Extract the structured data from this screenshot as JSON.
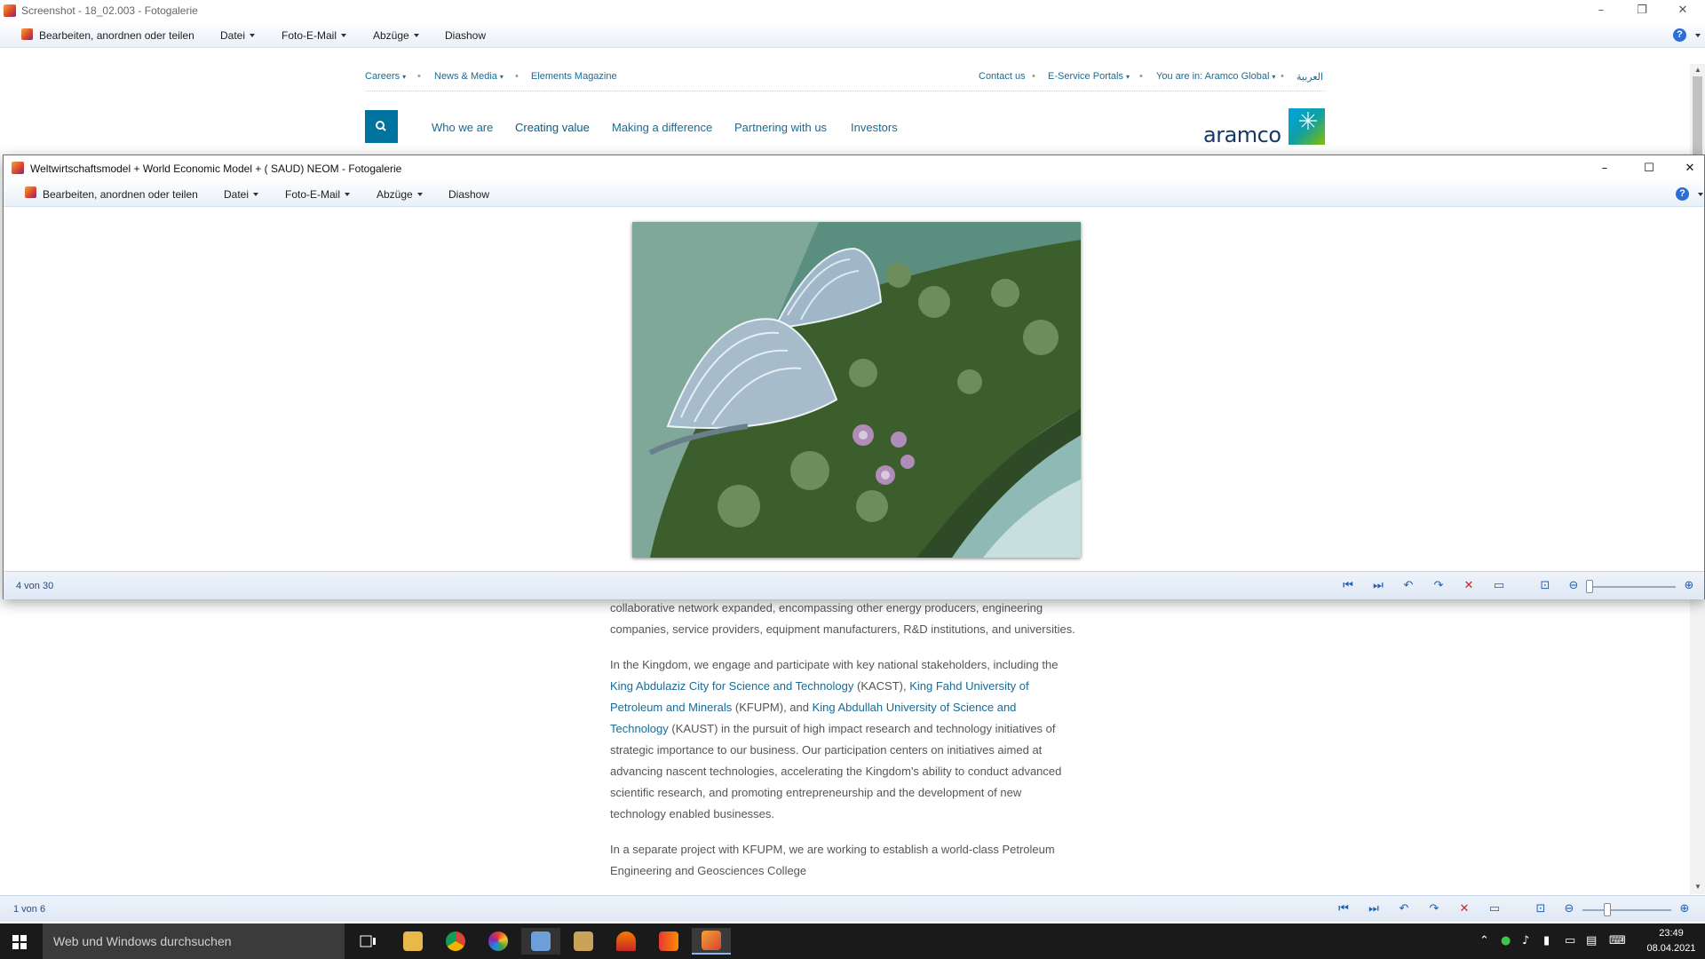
{
  "back_window": {
    "title": "Screenshot - 18_02.003 - Fotogalerie",
    "menu": {
      "edit": "Bearbeiten, anordnen oder teilen",
      "file": "Datei",
      "email": "Foto-E-Mail",
      "prints": "Abzüge",
      "slideshow": "Diashow"
    },
    "status_count": "1 von 6"
  },
  "webpage": {
    "topnav": {
      "careers": "Careers",
      "news": "News & Media",
      "elements": "Elements Magazine",
      "contact": "Contact us",
      "eservice": "E-Service Portals",
      "location": "You are in: Aramco Global",
      "arabic": "العربية"
    },
    "mainnav": {
      "who": "Who we are",
      "creating": "Creating value",
      "making": "Making a difference",
      "partnering": "Partnering with us",
      "investors": "Investors"
    },
    "logo_text": "aramco",
    "article": {
      "p1": "collaborative network expanded, encompassing other energy producers, engineering companies, service providers, equipment manufacturers, R&D institutions, and universities.",
      "p2_a": "In the Kingdom, we engage and participate with key national stakeholders, including the ",
      "p2_link1": "King Abdulaziz City for Science and Technology",
      "p2_b": " (KACST), ",
      "p2_link2": "King Fahd University of Petroleum and Minerals",
      "p2_c": " (KFUPM), and ",
      "p2_link3": "King Abdullah University of Science and Technology",
      "p2_d": " (KAUST) in the pursuit of high impact research and technology initiatives of strategic importance to our business. Our participation centers on initiatives aimed at advancing nascent technologies, accelerating the Kingdom's ability to conduct advanced scientific research, and promoting entrepreneurship and the development of new technology enabled businesses.",
      "p3": "In a separate project with KFUPM, we are working to establish a world-class Petroleum Engineering and Geosciences College"
    }
  },
  "front_window": {
    "title": "Weltwirtschaftsmodel + World Economic Model + ( SAUD) NEOM - Fotogalerie",
    "menu": {
      "edit": "Bearbeiten, anordnen oder teilen",
      "file": "Datei",
      "email": "Foto-E-Mail",
      "prints": "Abzüge",
      "slideshow": "Diashow"
    },
    "status_count": "4 von 30"
  },
  "taskbar": {
    "search_placeholder": "Web und Windows durchsuchen",
    "time": "23:49",
    "date": "08.04.2021"
  },
  "colors": {
    "aramco_blue": "#00a3e0",
    "link": "#1a6b94",
    "toolbar_blue": "#1f5fb8"
  }
}
